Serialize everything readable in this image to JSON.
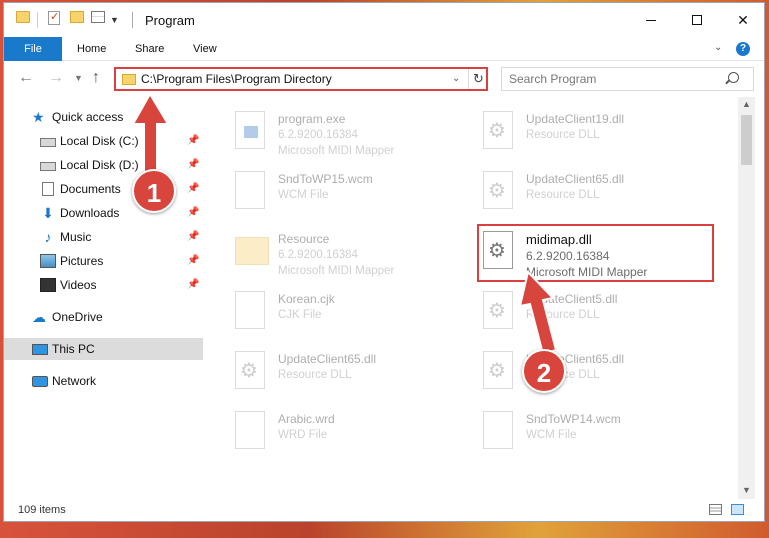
{
  "window": {
    "title": "Program"
  },
  "ribbon": {
    "tabs": [
      "File",
      "Home",
      "Share",
      "View"
    ]
  },
  "address_bar": {
    "path": "C:\\Program Files\\Program Directory"
  },
  "search": {
    "placeholder": "Search Program"
  },
  "sidebar": {
    "items": [
      {
        "label": "Quick access",
        "icon": "star-icon",
        "pinned": false
      },
      {
        "label": "Local Disk (C:)",
        "icon": "drive-icon",
        "pinned": true
      },
      {
        "label": "Local Disk (D:)",
        "icon": "drive-icon",
        "pinned": true
      },
      {
        "label": "Documents",
        "icon": "documents-icon",
        "pinned": true
      },
      {
        "label": "Downloads",
        "icon": "download-icon",
        "pinned": true
      },
      {
        "label": "Music",
        "icon": "music-icon",
        "pinned": true
      },
      {
        "label": "Pictures",
        "icon": "pictures-icon",
        "pinned": true
      },
      {
        "label": "Videos",
        "icon": "videos-icon",
        "pinned": true
      },
      {
        "label": "OneDrive",
        "icon": "cloud-icon",
        "pinned": false
      },
      {
        "label": "This PC",
        "icon": "computer-icon",
        "pinned": false,
        "selected": true
      },
      {
        "label": "Network",
        "icon": "network-icon",
        "pinned": false
      }
    ]
  },
  "files": [
    {
      "name": "program.exe",
      "line2": "6.2.9200.16384",
      "line3": "Microsoft MIDI Mapper",
      "icon": "exe-icon"
    },
    {
      "name": "UpdateClient19.dll",
      "line2": "Resource DLL",
      "line3": "",
      "icon": "gear-file-icon"
    },
    {
      "name": "SndToWP15.wcm",
      "line2": "WCM File",
      "line3": "",
      "icon": "document-icon"
    },
    {
      "name": "UpdateClient65.dll",
      "line2": "Resource DLL",
      "line3": "",
      "icon": "gear-file-icon"
    },
    {
      "name": "Resource",
      "line2": "6.2.9200.16384",
      "line3": "Microsoft MIDI Mapper",
      "icon": "folder-icon"
    },
    {
      "name": "midimap.dll",
      "line2": "6.2.9200.16384",
      "line3": "Microsoft MIDI Mapper",
      "icon": "gear-file-icon",
      "highlighted": true
    },
    {
      "name": "Korean.cjk",
      "line2": "CJK File",
      "line3": "",
      "icon": "document-icon"
    },
    {
      "name": "UpdateClient5.dll",
      "line2": "Resource DLL",
      "line3": "",
      "icon": "gear-file-icon"
    },
    {
      "name": "UpdateClient65.dll",
      "line2": "Resource DLL",
      "line3": "",
      "icon": "gear-file-icon"
    },
    {
      "name": "UpdateClient65.dll",
      "line2": "Resource DLL",
      "line3": "",
      "icon": "gear-file-icon"
    },
    {
      "name": "Arabic.wrd",
      "line2": "WRD File",
      "line3": "",
      "icon": "document-icon"
    },
    {
      "name": "SndToWP14.wcm",
      "line2": "WCM File",
      "line3": "",
      "icon": "document-icon"
    }
  ],
  "status": {
    "item_count": "109 items"
  },
  "annotations": {
    "step1": "1",
    "step2": "2"
  },
  "colors": {
    "accent": "#1979ca",
    "highlight": "#d94040",
    "annotation": "#d8453c"
  }
}
